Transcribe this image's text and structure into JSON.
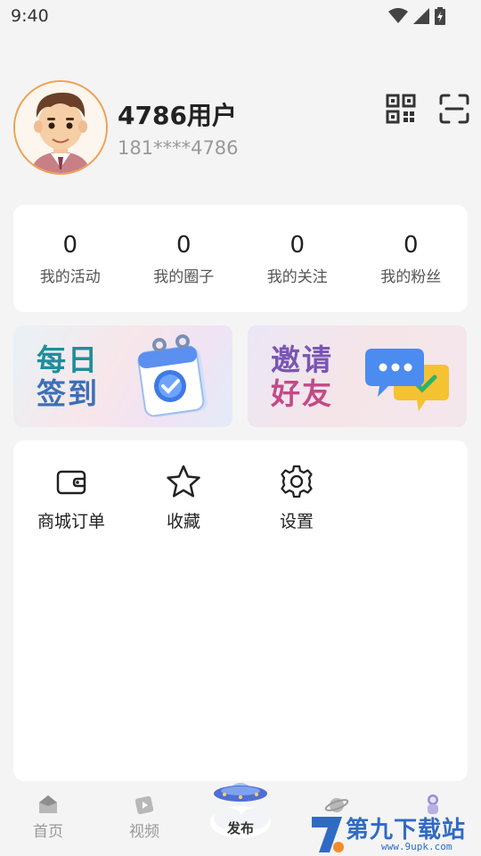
{
  "status_bar": {
    "time": "9:40"
  },
  "profile": {
    "username": "4786用户",
    "phone": "181****4786"
  },
  "stats": [
    {
      "value": "0",
      "label": "我的活动"
    },
    {
      "value": "0",
      "label": "我的圈子"
    },
    {
      "value": "0",
      "label": "我的关注"
    },
    {
      "value": "0",
      "label": "我的粉丝"
    }
  ],
  "banners": {
    "checkin": {
      "line1": "每日",
      "line2": "签到"
    },
    "invite": {
      "line1": "邀请",
      "line2": "好友"
    }
  },
  "menu": [
    {
      "label": "商城订单",
      "icon": "wallet-icon"
    },
    {
      "label": "收藏",
      "icon": "star-icon"
    },
    {
      "label": "设置",
      "icon": "gear-icon"
    }
  ],
  "tabbar": {
    "home": "首页",
    "video": "视频",
    "publish": "发布",
    "tab4": "",
    "tab5": ""
  },
  "watermark": {
    "title": "第九下载站",
    "url": "www.9upk.com"
  },
  "colors": {
    "accent": "#f0a050",
    "card": "#ffffff",
    "background": "#f4f4f4"
  }
}
